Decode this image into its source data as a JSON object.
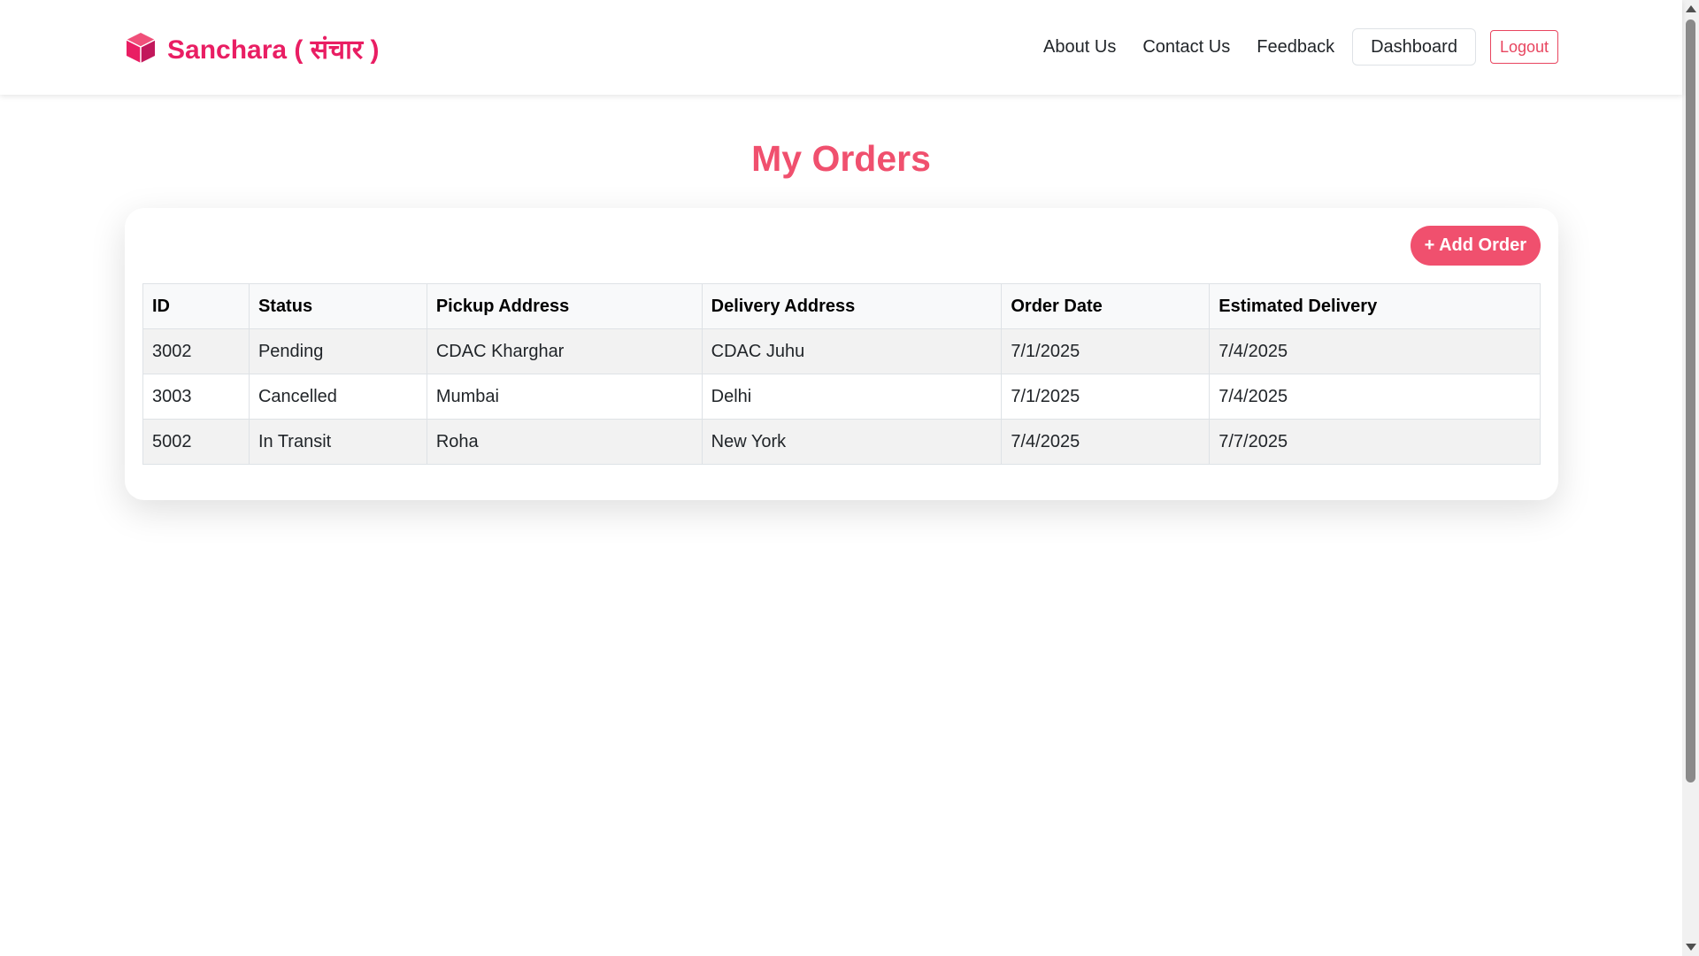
{
  "brand": {
    "name": "Sanchara ( संचार )",
    "icon": "cube-icon",
    "color": "#e91e63"
  },
  "nav": {
    "about": "About Us",
    "contact": "Contact Us",
    "feedback": "Feedback",
    "dashboard": "Dashboard",
    "logout": "Logout"
  },
  "page": {
    "title": "My Orders",
    "accent": "#f0506e"
  },
  "actions": {
    "add_order": "+ Add Order"
  },
  "table": {
    "headers": [
      "ID",
      "Status",
      "Pickup Address",
      "Delivery Address",
      "Order Date",
      "Estimated Delivery"
    ],
    "rows": [
      [
        "3002",
        "Pending",
        "CDAC Kharghar",
        "CDAC Juhu",
        "7/1/2025",
        "7/4/2025"
      ],
      [
        "3003",
        "Cancelled",
        "Mumbai",
        "Delhi",
        "7/1/2025",
        "7/4/2025"
      ],
      [
        "5002",
        "In Transit",
        "Roha",
        "New York",
        "7/4/2025",
        "7/7/2025"
      ]
    ]
  }
}
